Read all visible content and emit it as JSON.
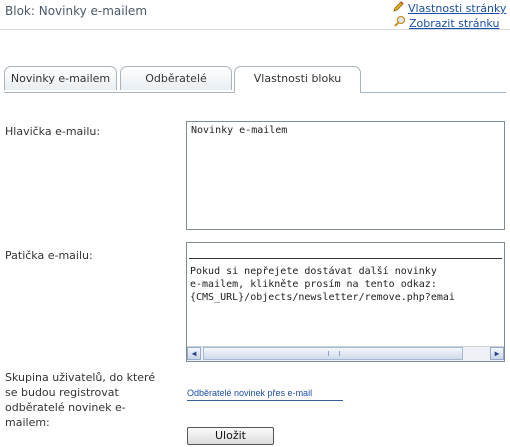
{
  "header": {
    "title": "Blok: Novinky e-mailem",
    "links": [
      {
        "label": "Vlastnosti stránky",
        "icon": "pencil-icon"
      },
      {
        "label": "Zobrazit stránku",
        "icon": "magnifier-icon"
      }
    ]
  },
  "tabs": [
    {
      "label": "Novinky e-mailem",
      "active": false
    },
    {
      "label": "Odběratelé",
      "active": false
    },
    {
      "label": "Vlastnosti bloku",
      "active": true
    }
  ],
  "form": {
    "header_label": "Hlavička e-mailu:",
    "header_value": "Novinky e-mailem",
    "footer_label": "Patička e-mailu:",
    "footer_value": "Pokud si nepřejete dostávat další novinky\ne-mailem, klikněte prosím na tento odkaz:\n{CMS_URL}/objects/newsletter/remove.php?emai",
    "group_label": "Skupina uživatelů, do které se budou registrovat odběratelé novinek e-mailem:",
    "group_value": "Odběratelé novinek přes e-mail",
    "save_label": "Uložit"
  },
  "colors": {
    "link": "#1d4fa8",
    "tab_border": "#a9b4bd",
    "title": "#4a5a6a"
  }
}
